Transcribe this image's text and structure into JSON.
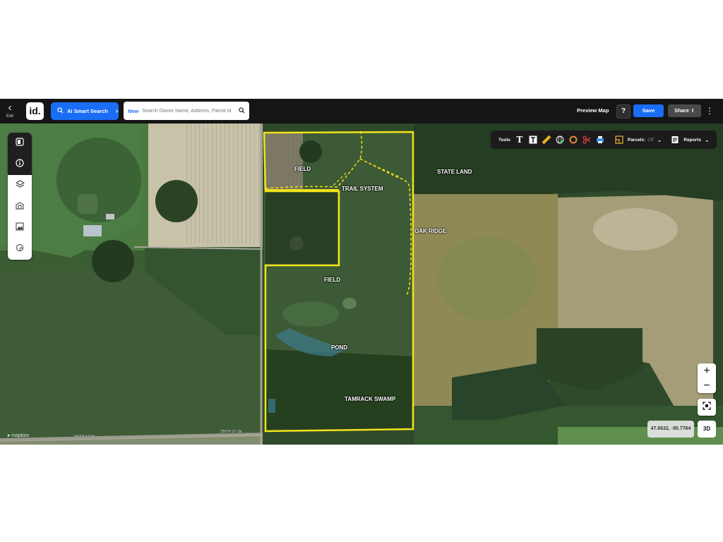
{
  "topbar": {
    "exit_label": "Exit",
    "logo": "id.",
    "ai_search_label": "AI Smart Search",
    "search": {
      "new_badge": "New",
      "placeholder": "Search Owner Name, Address, Parcel Id"
    },
    "preview_map_label": "Preview Map",
    "help_label": "?",
    "save_label": "Save",
    "share_label": "Share"
  },
  "toolbar": {
    "tools_label": "Tools",
    "parcels_label": "Parcels:",
    "parcels_state": "Off",
    "reports_label": "Reports"
  },
  "map_labels": {
    "field_north": "FIELD",
    "trail_system": "TRAIL SYSTEM",
    "state_land": "STATE LAND",
    "oak_ridge": "OAK RIDGE",
    "field_south": "FIELD",
    "pond": "POND",
    "tamrack_swamp": "TAMRACK SWAMP"
  },
  "roads": {
    "road_left": "250TH ST SE",
    "road_right": "250TH ST SE"
  },
  "coordinates": "47.6632, -95.7764",
  "controls": {
    "zoom_in": "+",
    "zoom_out": "−",
    "three_d": "3D"
  },
  "attribution": "mapbox",
  "colors": {
    "boundary": "#f2e21c",
    "accent": "#1a6ef5",
    "bar": "#151515"
  },
  "icons": [
    "exit-chevron-icon",
    "search-icon",
    "tablet-icon",
    "info-icon",
    "layers-icon",
    "building-icon",
    "image-icon",
    "location-icon",
    "text-icon",
    "text-box-icon",
    "ruler-icon",
    "globe-icon",
    "circle-icon",
    "scissors-icon",
    "print-icon",
    "parcels-icon",
    "reports-icon",
    "fit-bounds-icon"
  ]
}
